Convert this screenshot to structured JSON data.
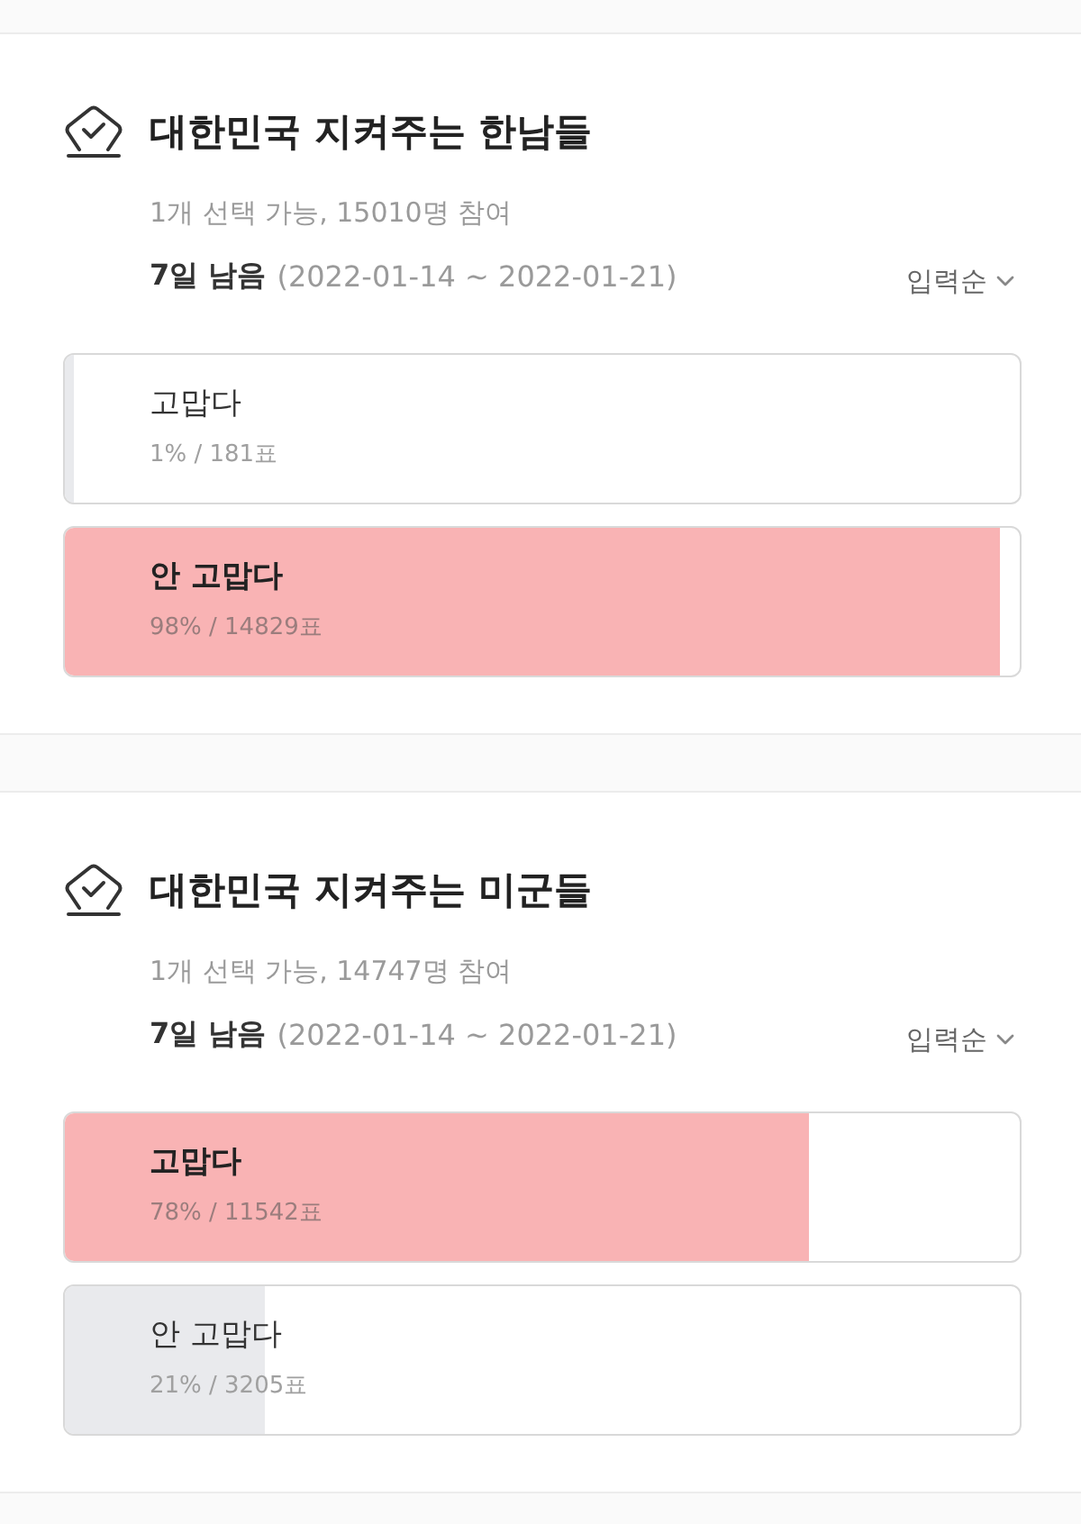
{
  "polls": [
    {
      "title": "대한민국 지켜주는 한남들",
      "summary": "1개 선택 가능, 15010명 참여",
      "remaining": "7일 남음",
      "period": "(2022-01-14 ~ 2022-01-21)",
      "sort": "입력순",
      "options": [
        {
          "label": "고맙다",
          "result": "1% / 181표",
          "level": 0.01,
          "leading": false
        },
        {
          "label": "안 고맙다",
          "result": "98% / 14829표",
          "level": 0.98,
          "leading": true
        }
      ]
    },
    {
      "title": "대한민국 지켜주는 미군들",
      "summary": "1개 선택 가능, 14747명 참여",
      "remaining": "7일 남음",
      "period": "(2022-01-14 ~ 2022-01-21)",
      "sort": "입력순",
      "options": [
        {
          "label": "고맙다",
          "result": "78% / 11542표",
          "level": 0.78,
          "leading": true
        },
        {
          "label": "안 고맙다",
          "result": "21% / 3205표",
          "level": 0.21,
          "leading": false
        }
      ]
    }
  ]
}
